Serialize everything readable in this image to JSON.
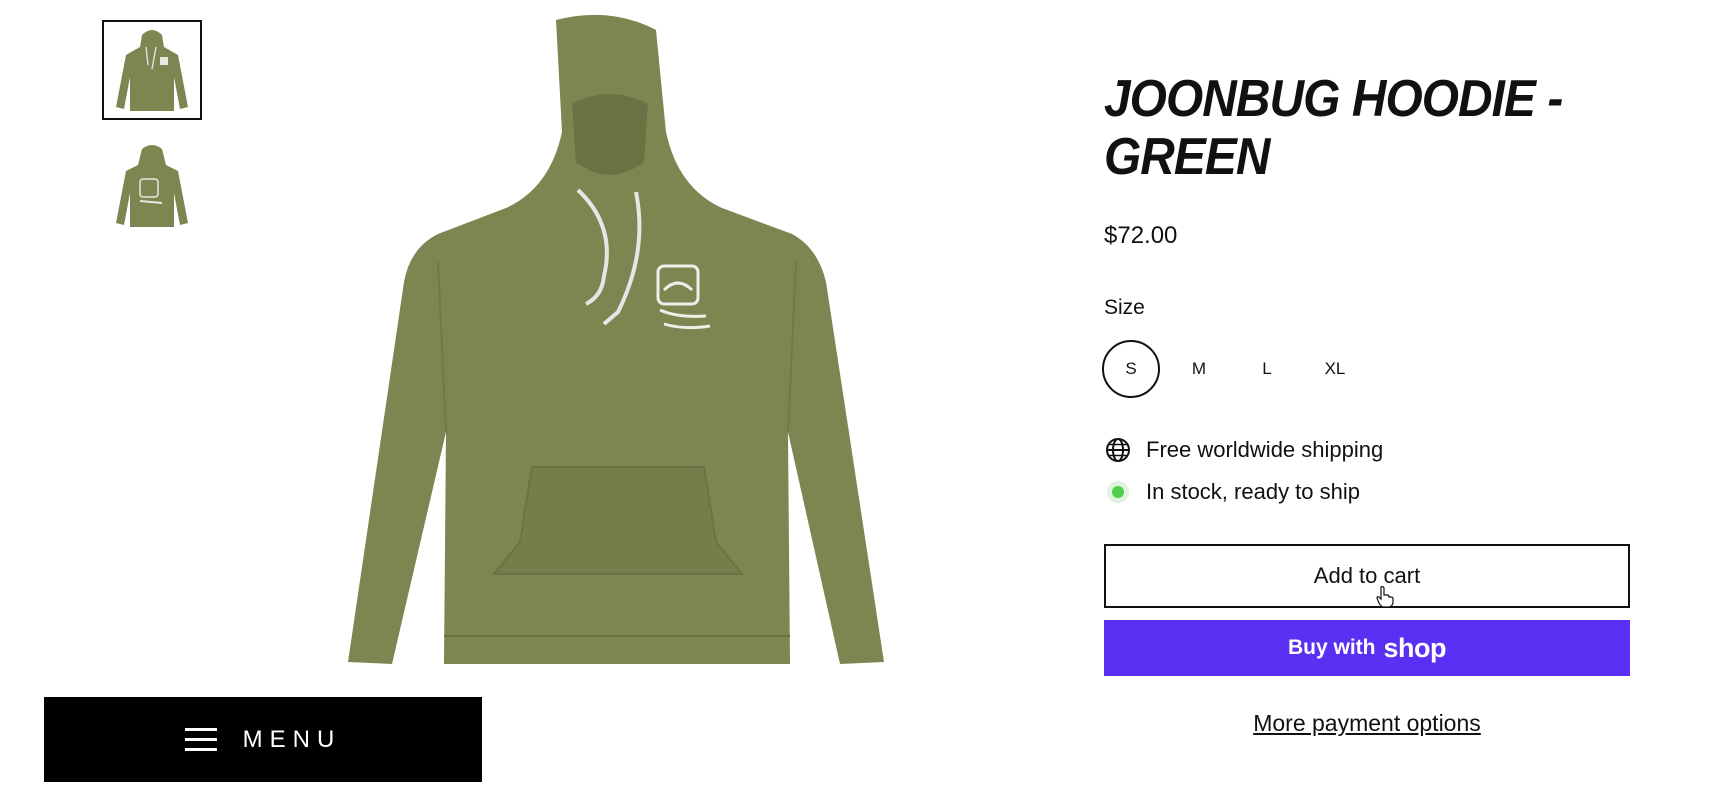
{
  "product": {
    "title": "JOONBUG HOODIE - GREEN",
    "price": "$72.00",
    "size_label": "Size",
    "sizes": [
      "S",
      "M",
      "L",
      "XL"
    ],
    "selected_size": "S",
    "features": {
      "shipping": "Free worldwide shipping",
      "stock": "In stock, ready to ship"
    },
    "add_to_cart": "Add to cart",
    "buy_with": "Buy with",
    "buy_brand": "shop",
    "more_payment": "More payment options"
  },
  "menu": {
    "label": "MENU"
  },
  "gallery": {
    "thumbnails": [
      "hoodie-front",
      "hoodie-back"
    ],
    "active_thumbnail": 0
  },
  "colors": {
    "hoodie": "#7f8550",
    "shop_button": "#5a31f4",
    "stock_dot": "#4fcf4a"
  },
  "icons": {
    "shipping": "globe-icon",
    "stock": "in-stock-dot-icon",
    "menu": "hamburger-icon"
  }
}
